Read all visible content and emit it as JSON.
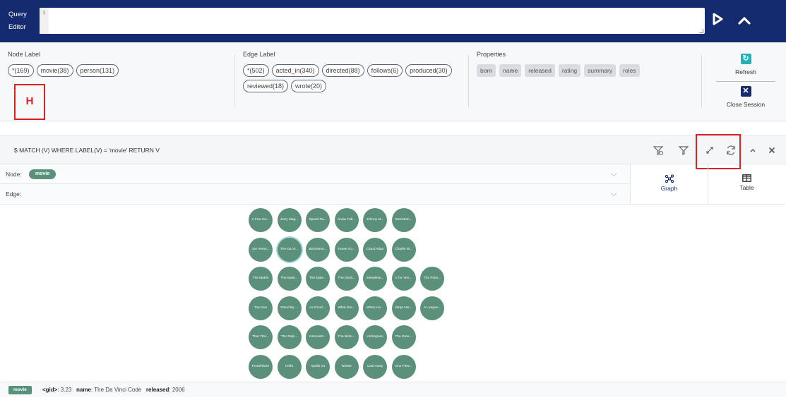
{
  "query_editor": {
    "title": "Query\nEditor",
    "gutter_line": "$",
    "value": ""
  },
  "meta": {
    "node_label_title": "Node Label",
    "node_labels": [
      "*(169)",
      "movie(38)",
      "person(131)"
    ],
    "edge_label_title": "Edge Label",
    "edge_labels": [
      "*(502)",
      "acted_in(340)",
      "directed(88)",
      "follows(6)",
      "produced(30)",
      "reviewed(18)",
      "wrote(20)"
    ],
    "properties_title": "Properties",
    "properties": [
      "born",
      "name",
      "released",
      "rating",
      "summary",
      "roles"
    ],
    "refresh_label": "Refresh",
    "close_label": "Close Session",
    "annotation": "H"
  },
  "frame": {
    "query": "$ MATCH (V) WHERE LABEL(V) = 'movie' RETURN V",
    "node_filter_label": "Node:",
    "node_filter_value": "movie",
    "edge_filter_label": "Edge:",
    "tab_graph": "Graph",
    "tab_table": "Table"
  },
  "graph": {
    "rows": [
      [
        "A Few Go...",
        "Jerry Mag...",
        "Speed Ra...",
        "Snow Fall...",
        "Johnny M...",
        "Somethin..."
      ],
      [
        "Joe Versu...",
        "The Da Vi...",
        "Bicentenn...",
        "Youve Go...",
        "Cloud Atlas",
        "Charlie W..."
      ],
      [
        "The Matrix",
        "The Matri...",
        "The Matri...",
        "The Devil...",
        "Sleepless...",
        "V for Ven...",
        "The Polar..."
      ],
      [
        "Top Gun",
        "Stand By ...",
        "As Good ...",
        "What Dre...",
        "When Ha...",
        "Ninja Ass...",
        "A League..."
      ],
      [
        "That Thin...",
        "The Repl...",
        "RescueD...",
        "The Birdc...",
        "Unforgiven",
        "The Gree..."
      ],
      [
        "Frost/Nixon",
        "Hoffa",
        "Apollo 13",
        "Twister",
        "Cast Away",
        "One Flew..."
      ]
    ]
  },
  "footer": {
    "label": "movie",
    "gid_key": "<gid>",
    "gid_value": ": 3.23",
    "name_key": "name",
    "name_value": ": The Da Vinci Code",
    "released_key": "released",
    "released_value": ": 2006"
  },
  "colors": {
    "navy": "#142b6f",
    "node": "#5b917b",
    "teal": "#21b1b8",
    "highlight": "#e02020"
  }
}
